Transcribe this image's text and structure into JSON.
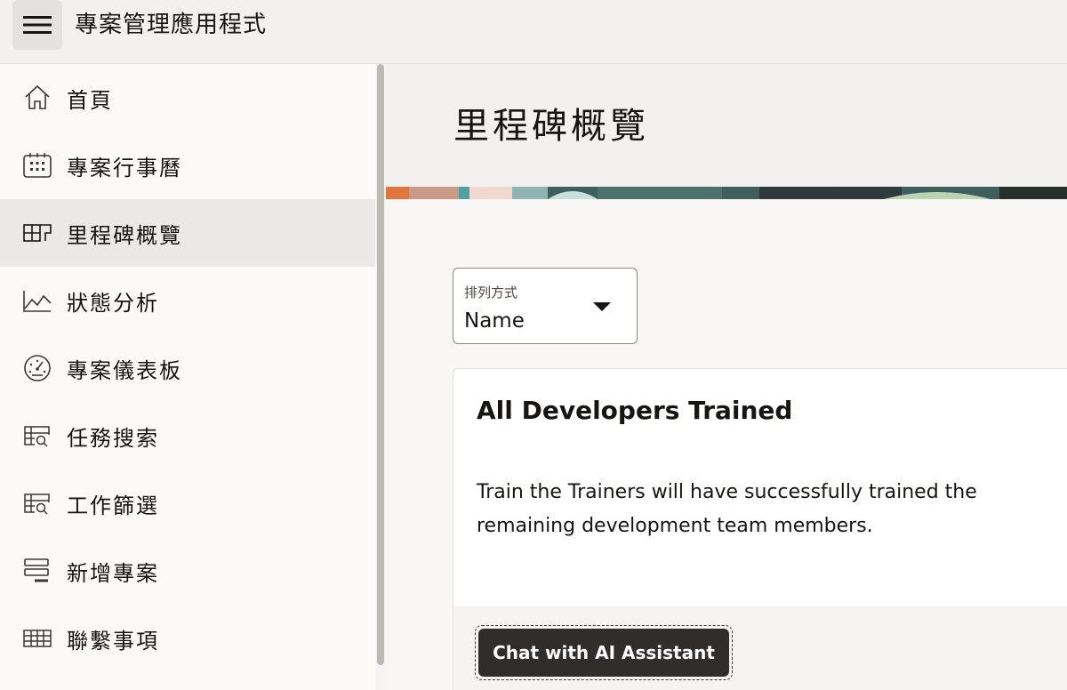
{
  "header": {
    "menu_icon": "hamburger-icon",
    "title": "專案管理應用程式"
  },
  "sidebar": {
    "items": [
      {
        "label": "首頁",
        "icon": "home-icon",
        "active": false
      },
      {
        "label": "專案行事曆",
        "icon": "calendar-icon",
        "active": false
      },
      {
        "label": "里程碑概覽",
        "icon": "milestone-grid-icon",
        "active": true
      },
      {
        "label": "狀態分析",
        "icon": "line-chart-icon",
        "active": false
      },
      {
        "label": "專案儀表板",
        "icon": "dashboard-gauge-icon",
        "active": false
      },
      {
        "label": "任務搜索",
        "icon": "table-search-icon",
        "active": false
      },
      {
        "label": "工作篩選",
        "icon": "table-search-icon",
        "active": false
      },
      {
        "label": "新增專案",
        "icon": "form-add-icon",
        "active": false
      },
      {
        "label": "聯繫事項",
        "icon": "table-icon",
        "active": false
      }
    ]
  },
  "main": {
    "page_title": "里程碑概覽",
    "sort": {
      "label": "排列方式",
      "value": "Name"
    },
    "card": {
      "title": "All Developers Trained",
      "description": "Train the Trainers will have successfully trained the remaining development team members.",
      "chat_button": "Chat with AI Assistant"
    }
  },
  "colors": {
    "header_bg": "#f2f1ef",
    "active_nav_bg": "#ebe9e6",
    "button_bg": "#312d2a",
    "page_bg": "#f8f7f5"
  }
}
